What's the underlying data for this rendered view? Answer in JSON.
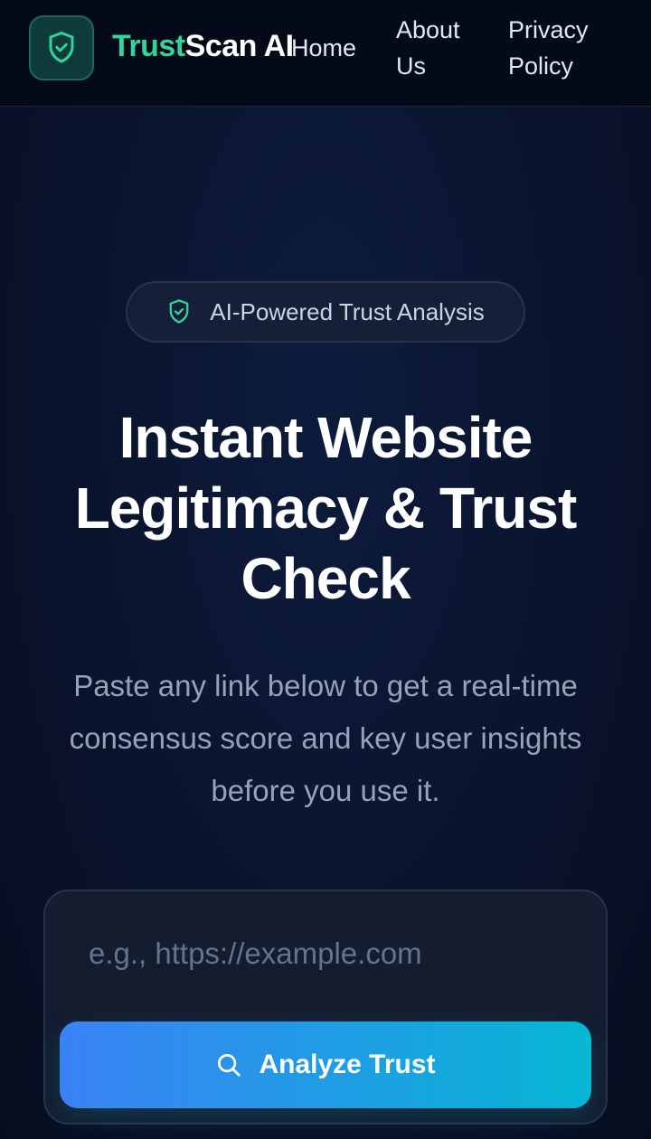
{
  "nav": {
    "brand_part1": "Trust",
    "brand_part2": "Scan AI",
    "home": "Home",
    "about": "About Us",
    "privacy": "Privacy Policy"
  },
  "hero": {
    "badge": "AI-Powered Trust Analysis",
    "headline": "Instant Website Legitimacy & Trust Check",
    "subtext": "Paste any link below to get a real-time consensus score and key user insights before you use it."
  },
  "search": {
    "placeholder": "e.g., https://example.com",
    "value": "",
    "button_label": "Analyze Trust"
  },
  "icons": {
    "logo": "shield-check-icon",
    "badge": "shield-check-icon",
    "button": "search-icon"
  },
  "colors": {
    "accent_green": "#34d399",
    "button_gradient_start": "#3b82f6",
    "button_gradient_end": "#06b6d4",
    "background": "#0a1530"
  }
}
